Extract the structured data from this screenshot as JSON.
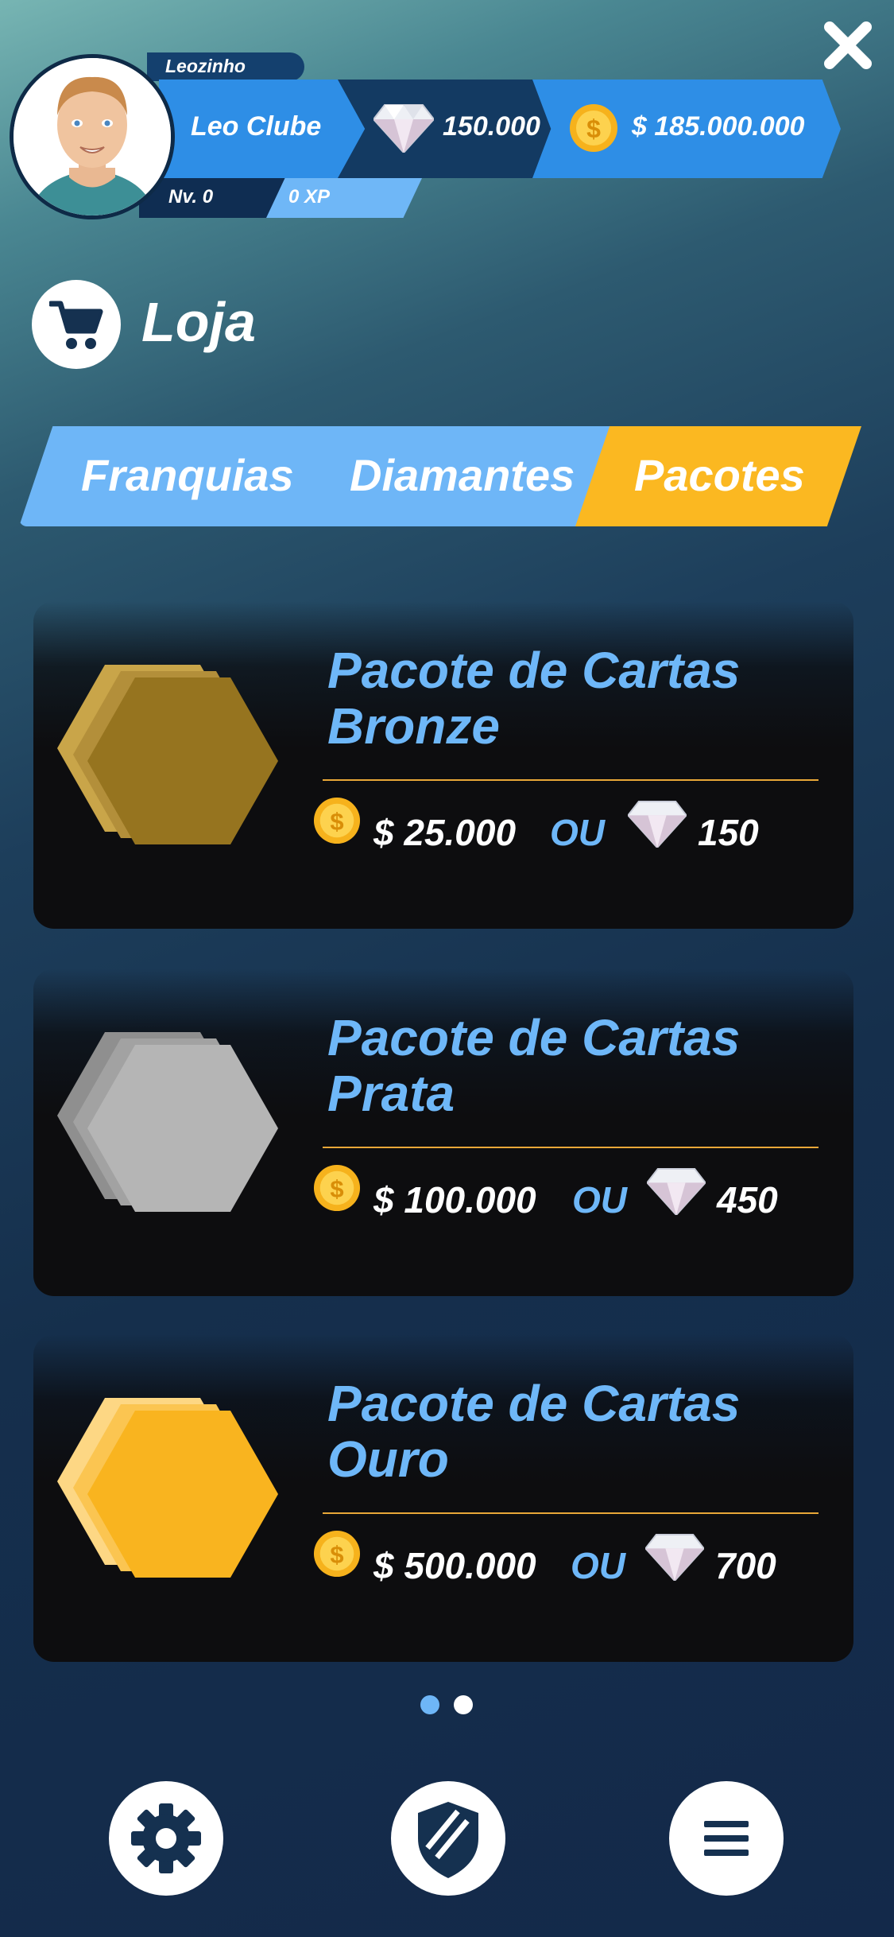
{
  "header": {
    "nickname": "Leozinho",
    "club": "Leo Clube",
    "diamonds": "150.000",
    "money": "$ 185.000.000",
    "level": "Nv.  0",
    "xp": "0  XP"
  },
  "page": {
    "title": "Loja"
  },
  "tabs": [
    {
      "label": "Franquias",
      "active": false
    },
    {
      "label": "Diamantes",
      "active": false
    },
    {
      "label": "Pacotes",
      "active": true
    }
  ],
  "packs": [
    {
      "title_line1": "Pacote de Cartas",
      "title_line2": "Bronze",
      "coin_price": "$ 25.000",
      "separator": "OU",
      "diamond_price": "150",
      "color": "#96741f",
      "color_light": "#c9a549"
    },
    {
      "title_line1": "Pacote de Cartas",
      "title_line2": "Prata",
      "coin_price": "$ 100.000",
      "separator": "OU",
      "diamond_price": "450",
      "color": "#b5b5b5",
      "color_light": "#909090"
    },
    {
      "title_line1": "Pacote de Cartas",
      "title_line2": "Ouro",
      "coin_price": "$ 500.000",
      "separator": "OU",
      "diamond_price": "700",
      "color": "#f9b41f",
      "color_light": "#fdd784"
    }
  ],
  "pagination": {
    "total": 2,
    "active": 1
  },
  "nav": [
    "gear-icon",
    "shield-icon",
    "menu-icon"
  ],
  "colors": {
    "accent_blue": "#6eb6f7",
    "accent_yellow": "#fbb821"
  }
}
